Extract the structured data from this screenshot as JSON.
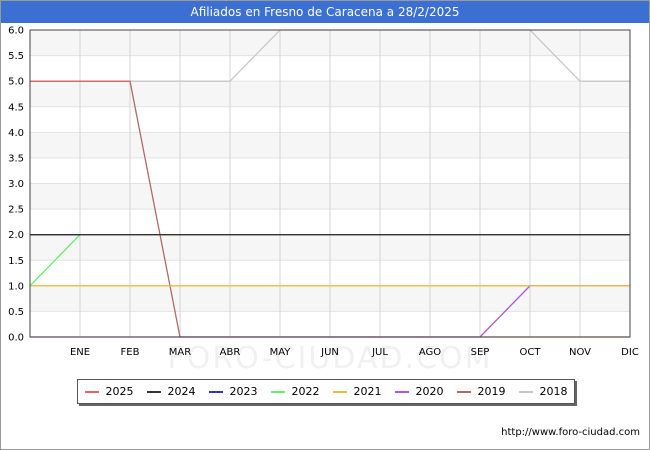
{
  "chart_data": {
    "type": "line",
    "title": "Afiliados en Fresno de Caracena a 28/2/2025",
    "xlabel": "",
    "ylabel": "",
    "categories": [
      "ENE",
      "FEB",
      "MAR",
      "ABR",
      "MAY",
      "JUN",
      "JUL",
      "AGO",
      "SEP",
      "OCT",
      "NOV",
      "DIC"
    ],
    "ylim": [
      0,
      6
    ],
    "yticks": [
      "0.0",
      "0.5",
      "1.0",
      "1.5",
      "2.0",
      "2.5",
      "3.0",
      "3.5",
      "4.0",
      "4.5",
      "5.0",
      "5.5",
      "6.0"
    ],
    "grid": true,
    "legend_position": "bottom",
    "series": [
      {
        "name": "2025",
        "color": "#e06666",
        "x": [
          "DIC",
          "ENE",
          "FEB"
        ],
        "values": [
          5,
          5,
          5
        ],
        "start_prev": true
      },
      {
        "name": "2024",
        "color": "#333333",
        "x": [
          "DIC",
          "ENE",
          "FEB",
          "MAR",
          "ABR",
          "MAY",
          "JUN",
          "JUL",
          "AGO",
          "SEP",
          "OCT",
          "NOV",
          "DIC"
        ],
        "values": [
          2,
          2,
          2,
          2,
          2,
          2,
          2,
          2,
          2,
          2,
          2,
          2,
          2
        ],
        "start_prev": true
      },
      {
        "name": "2023",
        "color": "#3333cc",
        "x": [
          "DIC",
          "ENE"
        ],
        "values": [
          2,
          2
        ],
        "start_prev": true
      },
      {
        "name": "2022",
        "color": "#66ee66",
        "x": [
          "DIC",
          "ENE",
          "FEB",
          "MAR",
          "ABR",
          "MAY",
          "JUN",
          "JUL",
          "AGO",
          "SEP",
          "OCT",
          "NOV",
          "DIC"
        ],
        "values": [
          1,
          2,
          2,
          2,
          2,
          2,
          2,
          2,
          2,
          2,
          2,
          2,
          2
        ],
        "start_prev": true
      },
      {
        "name": "2021",
        "color": "#f4b942",
        "x": [
          "DIC",
          "ENE",
          "FEB",
          "MAR",
          "ABR",
          "MAY",
          "JUN",
          "JUL",
          "AGO",
          "SEP",
          "OCT",
          "NOV",
          "DIC"
        ],
        "values": [
          1,
          1,
          1,
          1,
          1,
          1,
          1,
          1,
          1,
          1,
          1,
          1,
          1
        ],
        "start_prev": true
      },
      {
        "name": "2020",
        "color": "#aa55dd",
        "x": [
          "DIC",
          "ENE",
          "FEB",
          "MAR",
          "ABR",
          "MAY",
          "JUN",
          "JUL",
          "AGO",
          "SEP",
          "OCT",
          "NOV",
          "DIC"
        ],
        "values": [
          0,
          0,
          0,
          0,
          0,
          0,
          0,
          0,
          0,
          0,
          1,
          1,
          1
        ],
        "start_prev": true
      },
      {
        "name": "2019",
        "color": "#b06a6a",
        "x": [
          "DIC",
          "ENE",
          "FEB",
          "MAR",
          "ABR",
          "MAY",
          "JUN",
          "JUL",
          "AGO",
          "SEP",
          "OCT",
          "NOV",
          "DIC"
        ],
        "values": [
          5,
          5,
          5,
          0,
          0,
          0,
          0,
          0,
          0,
          0,
          0,
          0,
          0
        ],
        "start_prev": true
      },
      {
        "name": "2018",
        "color": "#c8c8c8",
        "x": [
          "DIC",
          "ENE",
          "FEB",
          "MAR",
          "ABR",
          "MAY",
          "JUN",
          "JUL",
          "AGO",
          "SEP",
          "OCT",
          "NOV",
          "DIC"
        ],
        "values": [
          5,
          5,
          5,
          5,
          5,
          6,
          6,
          6,
          6,
          6,
          6,
          5,
          5
        ],
        "start_prev": true
      }
    ]
  },
  "source": "http://www.foro-ciudad.com",
  "watermark": "FORO-CIUDAD.COM"
}
